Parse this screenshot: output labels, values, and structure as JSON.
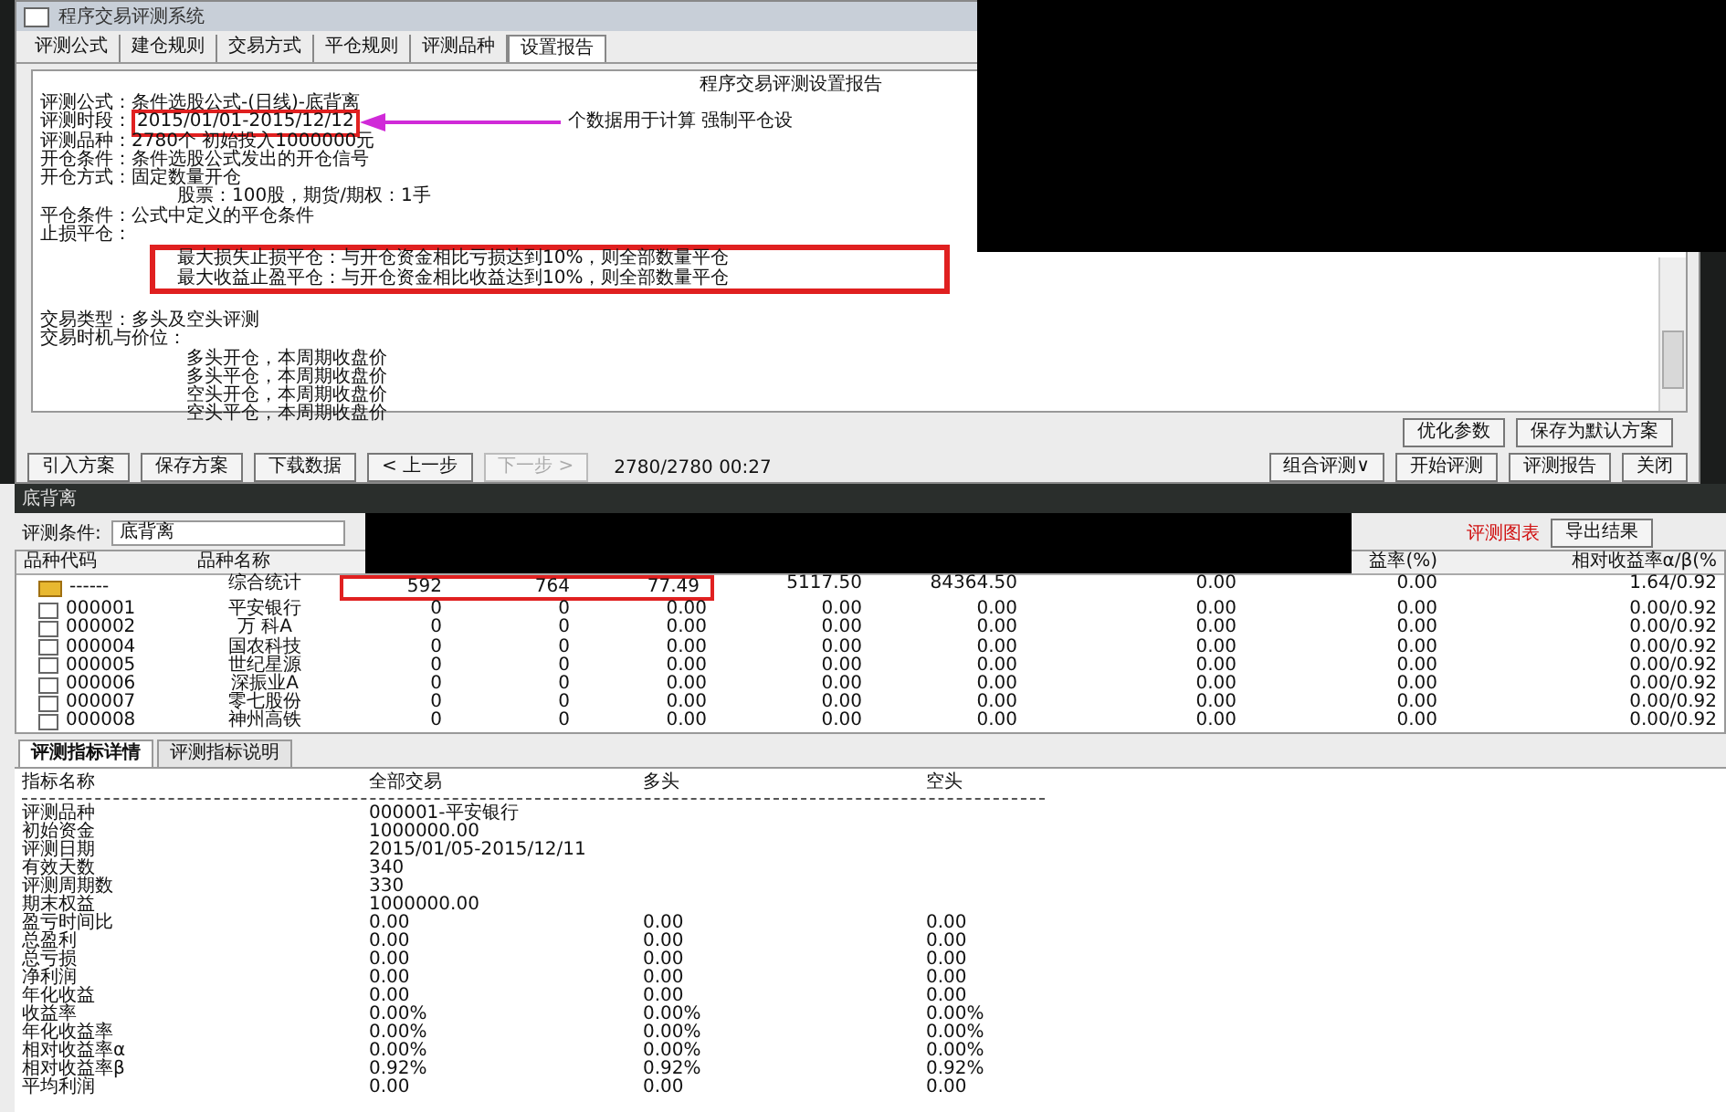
{
  "dialog": {
    "title": "程序交易评测系统",
    "tabs": [
      {
        "label": "评测公式",
        "selected": false
      },
      {
        "label": "建仓规则",
        "selected": false
      },
      {
        "label": "交易方式",
        "selected": false
      },
      {
        "label": "平仓规则",
        "selected": false
      },
      {
        "label": "评测品种",
        "selected": false
      },
      {
        "label": "设置报告",
        "selected": true
      }
    ],
    "report": {
      "title": "程序交易评测设置报告",
      "lines": [
        {
          "kind": "field",
          "label": "评测公式：",
          "text": "条件选股公式-(日线)-底背离"
        },
        {
          "kind": "field",
          "label": "评测时段：",
          "text": "2015/01/01-2015/12/12",
          "highlighted": true,
          "arrow": true,
          "extra": "个数据用于计算 强制平仓设"
        },
        {
          "kind": "field",
          "label": "评测品种：",
          "text": "2780个 初始投入1000000元"
        },
        {
          "kind": "field",
          "label": "开仓条件：",
          "text": "条件选股公式发出的开仓信号"
        },
        {
          "kind": "field",
          "label": "开仓方式：",
          "text": "固定数量开仓"
        },
        {
          "kind": "indent",
          "text": "股票：100股，期货/期权：1手"
        },
        {
          "kind": "field",
          "label": "平仓条件：",
          "text": "公式中定义的平仓条件"
        },
        {
          "kind": "field",
          "label": "止损平仓："
        },
        {
          "kind": "indent",
          "highlighted": true,
          "text": "最大损失止损平仓：与开仓资金相比亏损达到10%，则全部数量平仓"
        },
        {
          "kind": "indent",
          "highlighted": true,
          "text": "最大收益止盈平仓：与开仓资金相比收益达到10%，则全部数量平仓"
        },
        {
          "kind": "gap"
        },
        {
          "kind": "field",
          "label": "交易类型：",
          "text": "多头及空头评测"
        },
        {
          "kind": "field",
          "label": "交易时机与价位："
        },
        {
          "kind": "indent2",
          "text": "多头开仓，本周期收盘价"
        },
        {
          "kind": "indent2",
          "text": "多头平仓，本周期收盘价"
        },
        {
          "kind": "indent2",
          "text": "空头开仓，本周期收盘价"
        },
        {
          "kind": "indent2",
          "text": "空头平仓，本周期收盘价"
        }
      ]
    },
    "option_buttons": [
      {
        "label": "优化参数",
        "disabled": false
      },
      {
        "label": "保存为默认方案",
        "disabled": false
      }
    ],
    "left_buttons": [
      {
        "label": "引入方案",
        "disabled": false
      },
      {
        "label": "保存方案",
        "disabled": false
      },
      {
        "label": "下载数据",
        "disabled": false
      },
      {
        "label": "< 上一步",
        "disabled": false
      },
      {
        "label": "下一步 >",
        "disabled": true
      }
    ],
    "progress": "2780/2780 00:27",
    "right_buttons": [
      {
        "label": "组合评测∨",
        "disabled": false
      },
      {
        "label": "开始评测",
        "disabled": false
      },
      {
        "label": "评测报告",
        "disabled": false
      },
      {
        "label": "关闭",
        "disabled": false
      }
    ]
  },
  "result_window": {
    "title": "底背离",
    "condition_label": "评测条件:",
    "condition_value": "底背离",
    "chart_link": "评测图表",
    "export_button": "导出结果",
    "table": {
      "columns": [
        "品种代码",
        "品种名称"
      ],
      "right_columns": [
        "益率(%)",
        "相对收益率α/β(%"
      ],
      "rows": [
        {
          "kind": "summary",
          "highlighted": true,
          "code": "------",
          "name": "综合统计",
          "cells": [
            "592",
            "764",
            "77.49",
            "5117.50",
            "84364.50",
            "0.00",
            "0.00",
            "1.64/0.92"
          ]
        },
        {
          "kind": "stock",
          "checked": false,
          "code": "000001",
          "name": "平安银行",
          "cells": [
            "0",
            "0",
            "0.00",
            "0.00",
            "0.00",
            "0.00",
            "0.00",
            "0.00/0.92"
          ]
        },
        {
          "kind": "stock",
          "checked": false,
          "code": "000002",
          "name": "万 科A",
          "cells": [
            "0",
            "0",
            "0.00",
            "0.00",
            "0.00",
            "0.00",
            "0.00",
            "0.00/0.92"
          ]
        },
        {
          "kind": "stock",
          "checked": false,
          "code": "000004",
          "name": "国农科技",
          "cells": [
            "0",
            "0",
            "0.00",
            "0.00",
            "0.00",
            "0.00",
            "0.00",
            "0.00/0.92"
          ]
        },
        {
          "kind": "stock",
          "checked": false,
          "code": "000005",
          "name": "世纪星源",
          "cells": [
            "0",
            "0",
            "0.00",
            "0.00",
            "0.00",
            "0.00",
            "0.00",
            "0.00/0.92"
          ]
        },
        {
          "kind": "stock",
          "checked": false,
          "code": "000006",
          "name": "深振业A",
          "cells": [
            "0",
            "0",
            "0.00",
            "0.00",
            "0.00",
            "0.00",
            "0.00",
            "0.00/0.92"
          ]
        },
        {
          "kind": "stock",
          "checked": false,
          "code": "000007",
          "name": "零七股份",
          "cells": [
            "0",
            "0",
            "0.00",
            "0.00",
            "0.00",
            "0.00",
            "0.00",
            "0.00/0.92"
          ]
        },
        {
          "kind": "stock",
          "checked": false,
          "code": "000008",
          "name": "神州高铁",
          "cells": [
            "0",
            "0",
            "0.00",
            "0.00",
            "0.00",
            "0.00",
            "0.00",
            "0.00/0.92"
          ]
        }
      ]
    }
  },
  "details": {
    "tabs": [
      {
        "label": "评测指标详情",
        "selected": true
      },
      {
        "label": "评测指标说明",
        "selected": false
      }
    ],
    "columns": [
      "指标名称",
      "全部交易",
      "多头",
      "空头"
    ],
    "rows": [
      {
        "name": "评测品种",
        "values": [
          "000001-平安银行"
        ]
      },
      {
        "name": "初始资金",
        "values": [
          "1000000.00"
        ]
      },
      {
        "name": "评测日期",
        "values": [
          "2015/01/05-2015/12/11"
        ]
      },
      {
        "name": "有效天数",
        "values": [
          "340"
        ]
      },
      {
        "name": "评测周期数",
        "values": [
          "330"
        ]
      },
      {
        "name": "期末权益",
        "values": [
          "1000000.00"
        ]
      },
      {
        "name": "盈亏时间比",
        "values": [
          "0.00",
          "0.00",
          "0.00"
        ]
      },
      {
        "name": "总盈利",
        "values": [
          "0.00",
          "0.00",
          "0.00"
        ]
      },
      {
        "name": "总亏损",
        "values": [
          "0.00",
          "0.00",
          "0.00"
        ]
      },
      {
        "name": "净利润",
        "values": [
          "0.00",
          "0.00",
          "0.00"
        ]
      },
      {
        "name": "年化收益",
        "values": [
          "0.00",
          "0.00",
          "0.00"
        ]
      },
      {
        "name": "收益率",
        "values": [
          "0.00%",
          "0.00%",
          "0.00%"
        ]
      },
      {
        "name": "年化收益率",
        "values": [
          "0.00%",
          "0.00%",
          "0.00%"
        ]
      },
      {
        "name": "相对收益率α",
        "values": [
          "0.00%",
          "0.00%",
          "0.00%"
        ]
      },
      {
        "name": "相对收益率β",
        "values": [
          "0.92%",
          "0.92%",
          "0.92%"
        ]
      },
      {
        "name": "平均利润",
        "values": [
          "0.00",
          "0.00",
          "0.00"
        ]
      }
    ]
  }
}
